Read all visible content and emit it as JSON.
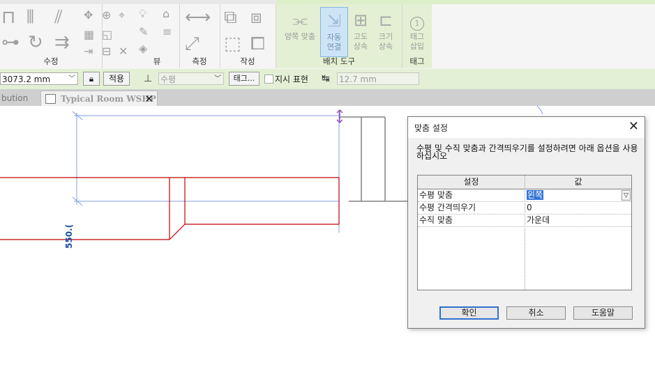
{
  "ribbon": {
    "panels": {
      "modify_label": "수정",
      "view_label": "뷰",
      "measure_label": "측정",
      "create_label": "작성",
      "layout_tools_label": "배치 도구",
      "tag_label": "태그"
    },
    "tools": {
      "both_align": "양쪽 맞춤",
      "auto_connect_1": "자동",
      "auto_connect_2": "연결",
      "inherit_elevation_1": "고도",
      "inherit_elevation_2": "상속",
      "inherit_size_1": "크기",
      "inherit_size_2": "상속",
      "tag_insert_1": "태그",
      "tag_insert_2": "삽입",
      "tag_number": "1"
    }
  },
  "options_bar": {
    "offset_value": "3073.2 mm",
    "apply_label": "적용",
    "orientation_value": "수평",
    "tag_value": "태그...",
    "leader_label": "지시 표현",
    "length_value": "12.7 mm"
  },
  "doc_tabs": {
    "inactive_tab": "bution",
    "active_tab": "Typical Room WSHP"
  },
  "canvas": {
    "dimension_text": "550.("
  },
  "dialog": {
    "title": "맞춤 설정",
    "description": "수평 및 수직 맞춤과 간격띄우기를 설정하려면 아래 옵션을 사용하십시오",
    "col_setting": "설정",
    "col_value": "값",
    "rows": [
      {
        "setting": "수평 맞춤",
        "value": "왼쪽"
      },
      {
        "setting": "수평 간격띄우기",
        "value": "0"
      },
      {
        "setting": "수직 맞춤",
        "value": "가운데"
      }
    ],
    "ok_label": "확인",
    "cancel_label": "취소",
    "help_label": "도움말"
  }
}
